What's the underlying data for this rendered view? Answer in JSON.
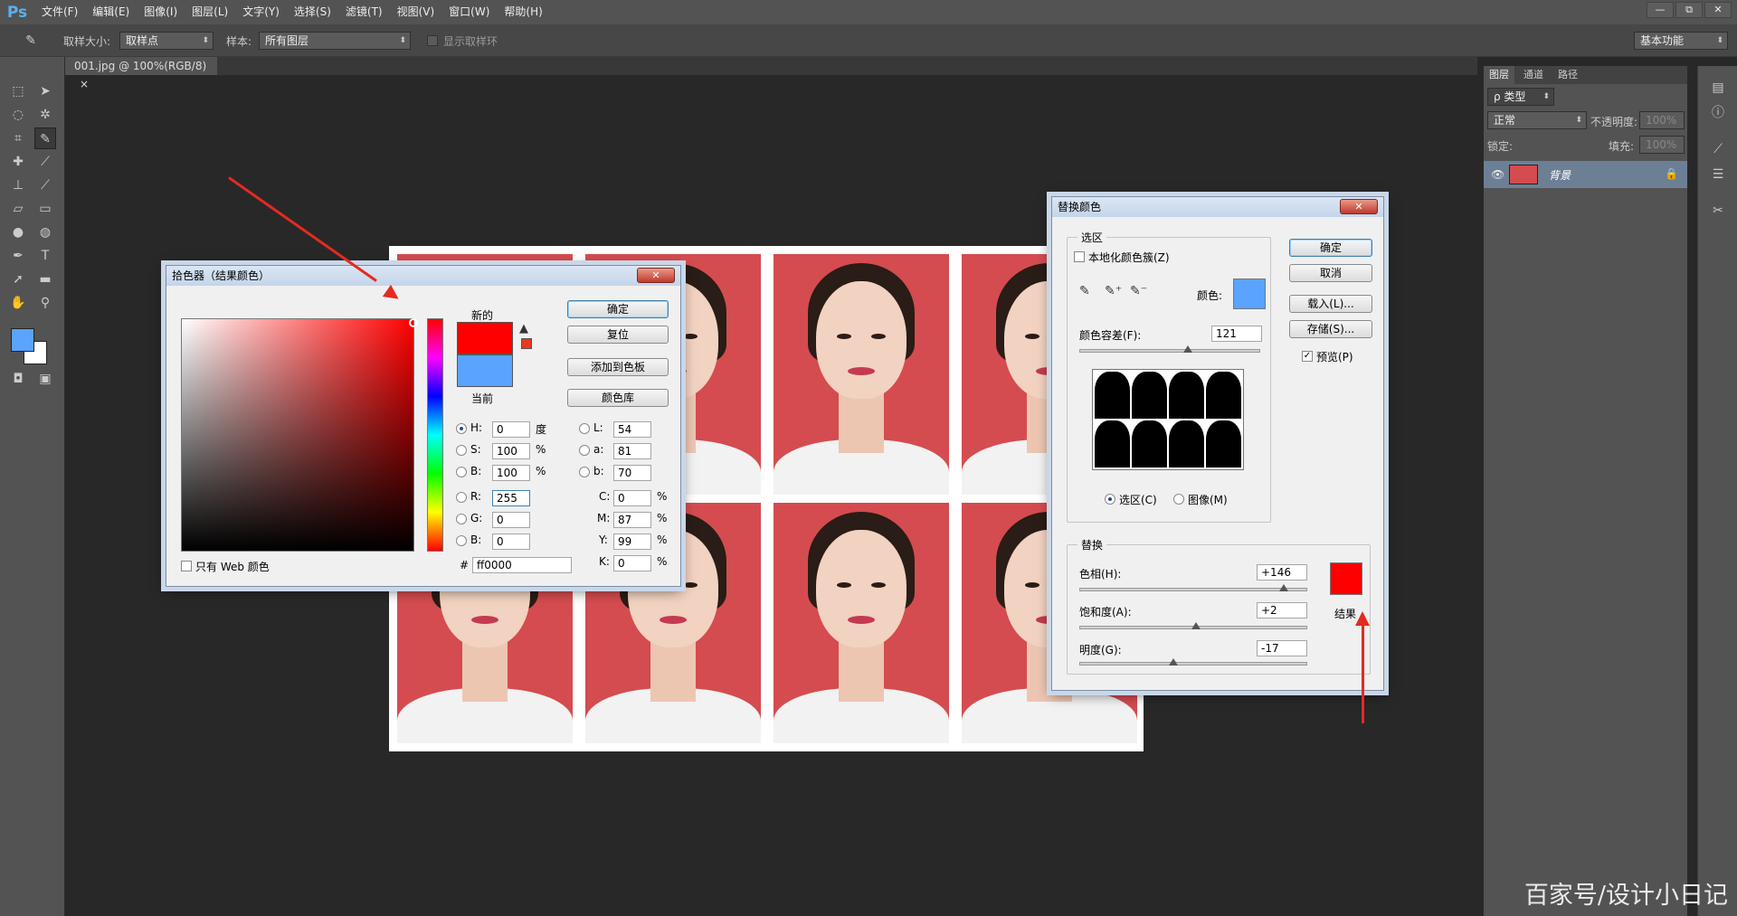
{
  "app": {
    "logo": "Ps"
  },
  "menu": [
    "文件(F)",
    "编辑(E)",
    "图像(I)",
    "图层(L)",
    "文字(Y)",
    "选择(S)",
    "滤镜(T)",
    "视图(V)",
    "窗口(W)",
    "帮助(H)"
  ],
  "window_controls": [
    "—",
    "⧉",
    "✕"
  ],
  "options": {
    "sample_size_label": "取样大小:",
    "sample_size_value": "取样点",
    "sample_label": "样本:",
    "sample_value": "所有图层",
    "show_ring_label": "显示取样环",
    "workspace": "基本功能"
  },
  "doc_tab": "001.jpg @ 100%(RGB/8)",
  "layers_panel": {
    "tabs": [
      "图层",
      "通道",
      "路径"
    ],
    "filter_kind": "ρ 类型",
    "blend_mode": "正常",
    "opacity_label": "不透明度:",
    "opacity_value": "100%",
    "lock_label": "锁定:",
    "fill_label": "填充:",
    "fill_value": "100%",
    "layer_name": "背景"
  },
  "color_picker": {
    "title": "拾色器（结果颜色）",
    "new_label": "新的",
    "current_label": "当前",
    "new_color": "#ff0000",
    "current_color": "#5aa3ff",
    "buttons": {
      "ok": "确定",
      "reset": "复位",
      "add_swatch": "添加到色板",
      "library": "颜色库"
    },
    "fields": {
      "H_label": "H:",
      "H": "0",
      "H_unit": "度",
      "S_label": "S:",
      "S": "100",
      "S_unit": "%",
      "B_label": "B:",
      "B": "100",
      "B_unit": "%",
      "R_label": "R:",
      "R": "255",
      "G_label": "G:",
      "G": "0",
      "Bl_label": "B:",
      "Bl": "0",
      "L_label": "L:",
      "L": "54",
      "a_label": "a:",
      "a": "81",
      "b_label": "b:",
      "b": "70",
      "C_label": "C:",
      "C": "0",
      "M_label": "M:",
      "M": "87",
      "Y_label": "Y:",
      "Y": "99",
      "K_label": "K:",
      "K": "0",
      "pct": "%",
      "hash": "#",
      "hex": "ff0000"
    },
    "web_only_label": "只有 Web 颜色"
  },
  "replace_color": {
    "title": "替换颜色",
    "selection_group": "选区",
    "localized_label": "本地化颜色簇(Z)",
    "color_label": "颜色:",
    "sample_color": "#5aa3ff",
    "fuzziness_label": "颜色容差(F):",
    "fuzziness_value": "121",
    "fuzziness_fraction": 0.6,
    "selection_radio": "选区(C)",
    "image_radio": "图像(M)",
    "replace_group": "替换",
    "hue_label": "色相(H):",
    "hue_value": "+146",
    "hue_fraction": 0.9,
    "sat_label": "饱和度(A):",
    "sat_value": "+2",
    "sat_fraction": 0.51,
    "light_label": "明度(G):",
    "light_value": "-17",
    "light_fraction": 0.41,
    "result_label": "结果",
    "result_color": "#ff0000",
    "buttons": {
      "ok": "确定",
      "cancel": "取消",
      "load": "载入(L)...",
      "save": "存储(S)..."
    },
    "preview_label": "预览(P)"
  },
  "watermark": "百家号/设计小日记"
}
